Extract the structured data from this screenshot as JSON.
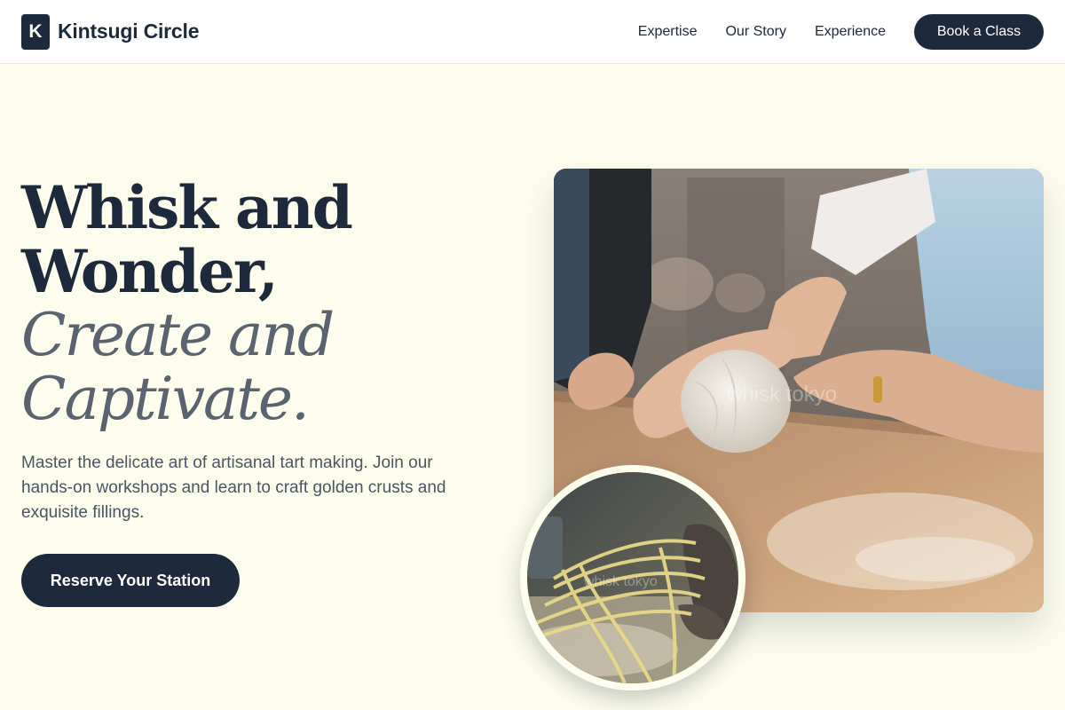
{
  "brand": {
    "mark": "K",
    "name": "Kintsugi Circle"
  },
  "nav": {
    "links": [
      "Expertise",
      "Our Story",
      "Experience"
    ],
    "cta": "Book a Class"
  },
  "hero": {
    "heading_bold": [
      "Whisk and",
      "Wonder,"
    ],
    "heading_italic": [
      "Create and",
      "Captivate."
    ],
    "subtitle": "Master the delicate art of artisanal tart making. Join our hands-on workshops and learn to craft golden crusts and exquisite fillings.",
    "cta": "Reserve Your Station"
  },
  "images": {
    "main_watermark": "whisk tokyo",
    "round_watermark": "whisk tokyo"
  },
  "colors": {
    "background": "#fefeee",
    "primary": "#1e293b",
    "muted_heading": "#5b6270",
    "body_text": "#4b5563"
  }
}
